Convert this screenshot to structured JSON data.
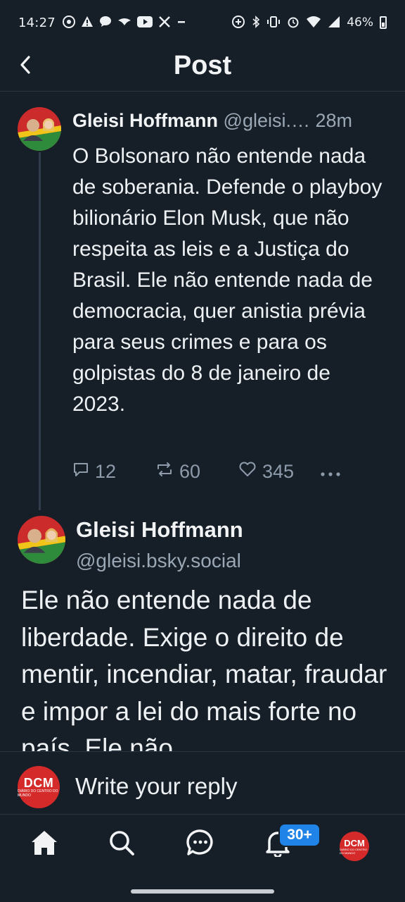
{
  "status_bar": {
    "time": "14:27",
    "left_icons": [
      "chrome-icon",
      "alert-icon",
      "chat-bubble-icon",
      "bird-icon",
      "youtube-icon",
      "x-icon",
      "dash-icon"
    ],
    "right_icons": [
      "data-saver-icon",
      "bluetooth-icon",
      "vibrate-icon",
      "alarm-icon",
      "wifi-icon",
      "signal-icon"
    ],
    "battery": "46%"
  },
  "header": {
    "title": "Post",
    "back_icon": "chevron-left-icon"
  },
  "posts": [
    {
      "author": "Gleisi Hoffmann",
      "handle": "@gleisi.…",
      "time": "28m",
      "text": "O Bolsonaro não entende nada de soberania. Defende o playboy bilionário Elon Musk, que não respeita as leis e a Justiça do Brasil. Ele não entende nada de democracia, quer anistia prévia para seus crimes e para os golpistas do 8 de janeiro de 2023.",
      "replies": "12",
      "reposts": "60",
      "likes": "345"
    },
    {
      "author": "Gleisi Hoffmann",
      "handle": "@gleisi.bsky.social",
      "text": "Ele não entende nada de liberdade. Exige o direito de mentir, incendiar, matar, fraudar e impor a lei do mais forte no país. Ele não"
    }
  ],
  "reply_bar": {
    "avatar_text": "DCM",
    "avatar_subtext": "DIÁRIO DO CENTRO DO MUNDO",
    "placeholder": "Write your reply"
  },
  "bottom_nav": {
    "items": [
      "home-icon",
      "search-icon",
      "chat-icon",
      "bell-icon",
      "profile-avatar"
    ],
    "notification_badge": "30+",
    "avatar_text": "DCM",
    "avatar_subtext": "DIÁRIO DO CENTRO DO MUNDO"
  },
  "colors": {
    "background": "#161e27",
    "text": "#f1f3f5",
    "muted": "#9aa7b5",
    "accent": "#1f83e8",
    "dcm_red": "#d42a2a"
  }
}
